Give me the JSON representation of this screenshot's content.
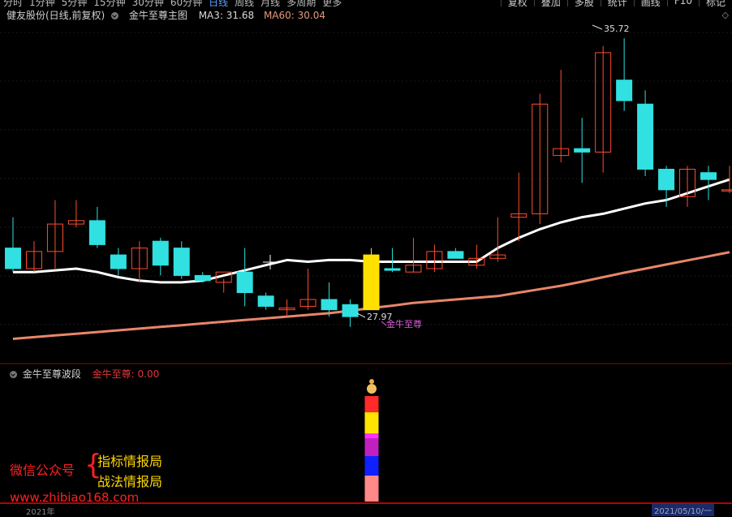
{
  "toolbar": {
    "periods": [
      "分时",
      "1分钟",
      "5分钟",
      "15分钟",
      "30分钟",
      "60分钟",
      "日线",
      "周线",
      "月线",
      "多周期",
      "更多"
    ],
    "active_period": "日线",
    "buttons": [
      "复权",
      "叠加",
      "多股",
      "统计",
      "画线",
      "F10",
      "标记"
    ]
  },
  "header": {
    "stock": "健友股份(日线,前复权)",
    "indicator": "金牛至尊主图",
    "ma3_label": "MA3: 31.68",
    "ma60_label": "MA60: 30.04"
  },
  "sub_header": {
    "name": "金牛至尊波段",
    "value_label": "金牛至尊: 0.00"
  },
  "annotations": {
    "high_label": "35.72",
    "low_label": "27.97",
    "signal_label": "金牛至尊"
  },
  "promo": {
    "wechat": "微信公众号",
    "line1": "指标情报局",
    "line2": "战法情报局",
    "url": "www.zhibiao168.com"
  },
  "axis": {
    "date_left": "2021年",
    "date_right": "2021/05/10/一"
  },
  "colors": {
    "up": "#ff4d2e",
    "down": "#31e0e0",
    "signal": "#ffe000",
    "ma3": "#ffffff",
    "ma60": "#e8866a"
  },
  "chart_data": {
    "type": "candlestick",
    "candles": [
      {
        "o": 29.6,
        "h": 30.5,
        "l": 28.9,
        "c": 29.0
      },
      {
        "o": 29.0,
        "h": 29.8,
        "l": 28.9,
        "c": 29.5
      },
      {
        "o": 29.5,
        "h": 31.0,
        "l": 29.0,
        "c": 30.3
      },
      {
        "o": 30.3,
        "h": 31.0,
        "l": 30.2,
        "c": 30.4
      },
      {
        "o": 30.4,
        "h": 30.8,
        "l": 29.6,
        "c": 29.7
      },
      {
        "o": 29.4,
        "h": 29.6,
        "l": 28.8,
        "c": 29.0
      },
      {
        "o": 29.0,
        "h": 29.8,
        "l": 28.6,
        "c": 29.6
      },
      {
        "o": 29.8,
        "h": 29.9,
        "l": 28.8,
        "c": 29.1
      },
      {
        "o": 29.6,
        "h": 29.8,
        "l": 28.7,
        "c": 28.8
      },
      {
        "o": 28.8,
        "h": 28.9,
        "l": 28.6,
        "c": 28.65
      },
      {
        "o": 28.6,
        "h": 28.7,
        "l": 28.3,
        "c": 28.9
      },
      {
        "o": 28.9,
        "h": 29.6,
        "l": 27.9,
        "c": 28.3
      },
      {
        "o": 28.2,
        "h": 28.3,
        "l": 27.8,
        "c": 27.9
      },
      {
        "o": 27.8,
        "h": 28.1,
        "l": 27.6,
        "c": 27.85
      },
      {
        "o": 27.9,
        "h": 29.0,
        "l": 27.8,
        "c": 28.1
      },
      {
        "o": 28.1,
        "h": 28.6,
        "l": 27.6,
        "c": 27.8
      },
      {
        "o": 27.95,
        "h": 28.1,
        "l": 27.3,
        "c": 27.6
      },
      {
        "o": 27.8,
        "h": 29.6,
        "l": 27.8,
        "c": 29.4
      },
      {
        "o": 29.0,
        "h": 29.6,
        "l": 28.9,
        "c": 28.95
      },
      {
        "o": 28.9,
        "h": 29.9,
        "l": 28.9,
        "c": 29.1
      },
      {
        "o": 29.0,
        "h": 29.7,
        "l": 28.9,
        "c": 29.5
      },
      {
        "o": 29.5,
        "h": 29.6,
        "l": 29.4,
        "c": 29.3
      },
      {
        "o": 29.1,
        "h": 29.7,
        "l": 29.0,
        "c": 29.3
      },
      {
        "o": 29.3,
        "h": 30.5,
        "l": 29.2,
        "c": 29.4
      },
      {
        "o": 30.5,
        "h": 31.8,
        "l": 29.8,
        "c": 30.6
      },
      {
        "o": 30.6,
        "h": 34.1,
        "l": 30.3,
        "c": 33.8
      },
      {
        "o": 32.3,
        "h": 34.8,
        "l": 32.1,
        "c": 32.5
      },
      {
        "o": 32.5,
        "h": 33.4,
        "l": 31.5,
        "c": 32.4
      },
      {
        "o": 32.4,
        "h": 35.5,
        "l": 31.8,
        "c": 35.3
      },
      {
        "o": 34.5,
        "h": 35.72,
        "l": 33.6,
        "c": 33.9
      },
      {
        "o": 33.8,
        "h": 34.2,
        "l": 31.7,
        "c": 31.9
      },
      {
        "o": 31.9,
        "h": 32.0,
        "l": 30.8,
        "c": 31.3
      },
      {
        "o": 31.1,
        "h": 32.0,
        "l": 30.8,
        "c": 31.9
      },
      {
        "o": 31.8,
        "h": 32.0,
        "l": 31.0,
        "c": 31.6
      },
      {
        "o": 31.3,
        "h": 32.0,
        "l": 31.2,
        "c": 31.3
      }
    ],
    "signal_candle_index": 17,
    "ma3": [
      28.9,
      28.9,
      28.95,
      29.0,
      28.9,
      28.75,
      28.65,
      28.6,
      28.6,
      28.65,
      28.8,
      28.95,
      29.1,
      29.25,
      29.2,
      29.25,
      29.25,
      29.2,
      29.2,
      29.2,
      29.2,
      29.2,
      29.2,
      29.6,
      29.9,
      30.15,
      30.35,
      30.5,
      30.6,
      30.75,
      30.9,
      31.0,
      31.2,
      31.4,
      31.6
    ],
    "ma60": [
      26.95,
      27.0,
      27.05,
      27.1,
      27.15,
      27.2,
      27.25,
      27.3,
      27.35,
      27.4,
      27.45,
      27.5,
      27.55,
      27.6,
      27.65,
      27.7,
      27.77,
      27.85,
      27.92,
      28.0,
      28.05,
      28.1,
      28.15,
      28.2,
      28.3,
      28.4,
      28.5,
      28.62,
      28.75,
      28.88,
      29.0,
      29.12,
      29.24,
      29.36,
      29.48
    ],
    "signal_value": 0.0
  }
}
